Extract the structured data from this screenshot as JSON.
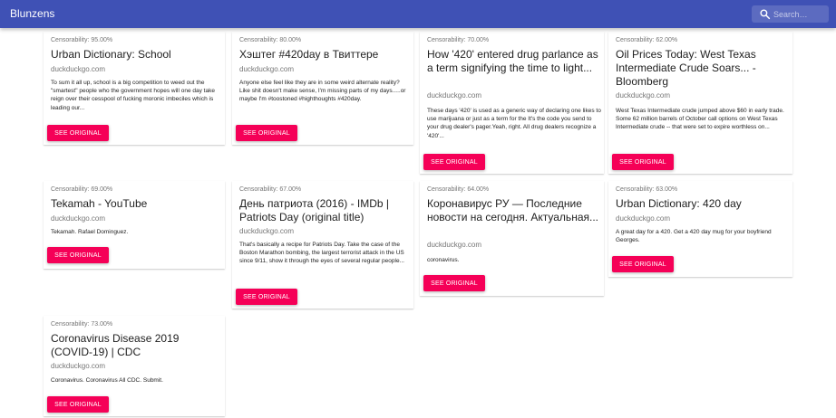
{
  "app": {
    "title": "Blunzens",
    "search_placeholder": "Search…",
    "accent_color": "#3f51b5",
    "button_color": "#f50057"
  },
  "cards": [
    {
      "score": "Censorability: 95.00%",
      "title": "Urban Dictionary: School",
      "source": "duckduckgo.com",
      "description": "To sum it all up, school is a big competition to weed out the \"smartest\" people who the government hopes will one day take reign over their cesspool of fucking moronic imbeciles which is leading our...",
      "button": "See Original"
    },
    {
      "score": "Censorability: 80.00%",
      "title": "Хэштег #420day в Твиттере",
      "source": "duckduckgo.com",
      "description": "Anyone else feel like they are in some weird alternate reality? Like shit doesn't make sense, I'm missing parts of my days.....or maybe I'm #toostoned #highthoughts #420day.",
      "button": "See Original"
    },
    {
      "score": "Censorability: 70.00%",
      "title": "How '420' entered drug parlance as a term signifying the time to light...",
      "source": "duckduckgo.com",
      "description": "These days '420' is used as a generic way of declaring one likes to use marijuana or just as a term for the It's the code you send to your drug dealer's pager.Yeah, right. All drug dealers recognize a '420'...",
      "button": "See Original"
    },
    {
      "score": "Censorability: 62.00%",
      "title": "Oil Prices Today: West Texas Intermediate Crude Soars... - Bloomberg",
      "source": "duckduckgo.com",
      "description": "West Texas Intermediate crude jumped above $60 in early trade. Some 62 million barrels of October call options on West Texas Intermediate crude -- that were set to expire worthless on...",
      "button": "See Original"
    },
    {
      "score": "Censorability: 69.00%",
      "title": "Tekamah - YouTube",
      "source": "duckduckgo.com",
      "description": "Tekamah. Rafael Dominguez.",
      "button": "See Original"
    },
    {
      "score": "Censorability: 67.00%",
      "title": "День патриота (2016) - IMDb | Patriots Day (original title)",
      "source": "duckduckgo.com",
      "description": "That's basically a recipe for Patriots Day. Take the case of the Boston Marathon bombing, the largest terrorist attack in the US since 9/11, show it through the eyes of several regular people...",
      "button": "See Original"
    },
    {
      "score": "Censorability: 64.00%",
      "title": "Коронавирус РУ — Последние новости на сегодня. Актуальная...",
      "source": "duckduckgo.com",
      "description": "coronavirus.",
      "button": "See Original"
    },
    {
      "score": "Censorability: 63.00%",
      "title": "Urban Dictionary: 420 day",
      "source": "duckduckgo.com",
      "description": "A great day for a 420. Get a 420 day mug for your boyfriend Georges.",
      "button": "See Original"
    },
    {
      "score": "Censorability: 73.00%",
      "title": "Coronavirus Disease 2019 (COVID-19) | CDC",
      "source": "duckduckgo.com",
      "description": "Coronavirus. Coronavirus All CDC. Submit.",
      "button": "See Original"
    }
  ]
}
